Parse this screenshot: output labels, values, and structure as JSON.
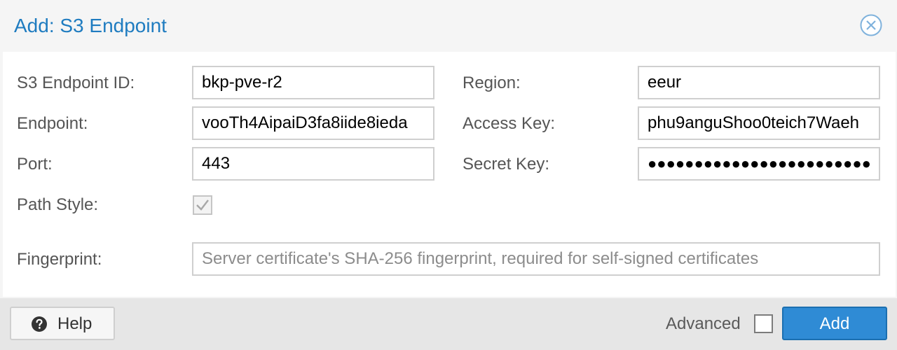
{
  "dialog": {
    "title": "Add: S3 Endpoint"
  },
  "form": {
    "endpoint_id": {
      "label": "S3 Endpoint ID:",
      "value": "bkp-pve-r2"
    },
    "endpoint": {
      "label": "Endpoint:",
      "value": "vooTh4AipaiD3fa8iide8ieda"
    },
    "port": {
      "label": "Port:",
      "value": "443"
    },
    "path_style": {
      "label": "Path Style:",
      "checked": true,
      "disabled": true
    },
    "fingerprint": {
      "label": "Fingerprint:",
      "value": "",
      "placeholder": "Server certificate's SHA-256 fingerprint, required for self-signed certificates"
    },
    "region": {
      "label": "Region:",
      "value": "eeur"
    },
    "access_key": {
      "label": "Access Key:",
      "value": "phu9anguShoo0teich7Waeh"
    },
    "secret_key": {
      "label": "Secret Key:",
      "value": "●●●●●●●●●●●●●●●●●●●●●●●●"
    }
  },
  "footer": {
    "help_label": "Help",
    "advanced_label": "Advanced",
    "advanced_checked": false,
    "add_label": "Add"
  },
  "icons": {
    "close": "close-circle-icon",
    "help": "question-circle-icon",
    "check": "checkmark-icon"
  },
  "colors": {
    "title": "#1f7cc0",
    "primary_button": "#2f8bd5"
  }
}
